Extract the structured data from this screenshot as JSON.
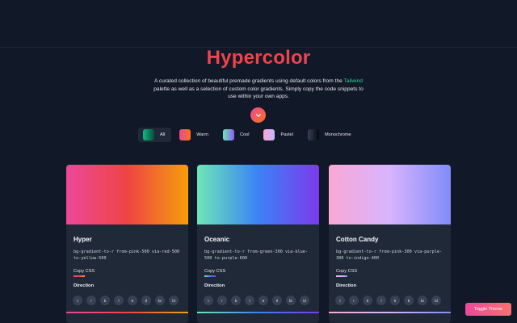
{
  "header": {
    "title": "Hypercolor",
    "intro_part1": "A curated collection of beautiful premade gradients using default colors from the ",
    "intro_highlight": "Tailwind",
    "intro_part2": " palette as well as a selection of custom color gradients. Simply copy the code snippets to use within your own apps."
  },
  "filters": [
    {
      "label": "All",
      "swatch_from": "#10b981",
      "swatch_to": "#064e3b",
      "active": true
    },
    {
      "label": "Warm",
      "swatch_from": "#ec4899",
      "swatch_to": "#f97316",
      "active": false
    },
    {
      "label": "Cool",
      "swatch_from": "#6ee7b7",
      "swatch_to": "#8b5cf6",
      "active": false
    },
    {
      "label": "Pastel",
      "swatch_from": "#f9a8d4",
      "swatch_to": "#c4b5fd",
      "active": false
    },
    {
      "label": "Monochrome",
      "swatch_from": "#374151",
      "swatch_to": "#030712",
      "active": false
    }
  ],
  "cards": [
    {
      "name": "Hyper",
      "code": "bg-gradient-to-r from-pink-500 via-red-500 to-yellow-500",
      "copy_label": "Copy CSS",
      "direction_label": "Direction",
      "colors": [
        "#ec4899",
        "#ef4444",
        "#f59e0b"
      ]
    },
    {
      "name": "Oceanic",
      "code": "bg-gradient-to-r from-green-300 via-blue-500 to-purple-600",
      "copy_label": "Copy CSS",
      "direction_label": "Direction",
      "colors": [
        "#6ee7b7",
        "#3b82f6",
        "#7c3aed"
      ]
    },
    {
      "name": "Cotton Candy",
      "code": "bg-gradient-to-r from-pink-300 via-purple-300 to-indigo-400",
      "copy_label": "Copy CSS",
      "direction_label": "Direction",
      "colors": [
        "#f9a8d4",
        "#d8b4fe",
        "#818cf8"
      ]
    }
  ],
  "directions": [
    "t",
    "r",
    "b",
    "l",
    "tr",
    "tl",
    "br",
    "bl"
  ],
  "toggle_theme": "Toggle Theme",
  "icons": {
    "scroll": "chevron-down-icon"
  }
}
